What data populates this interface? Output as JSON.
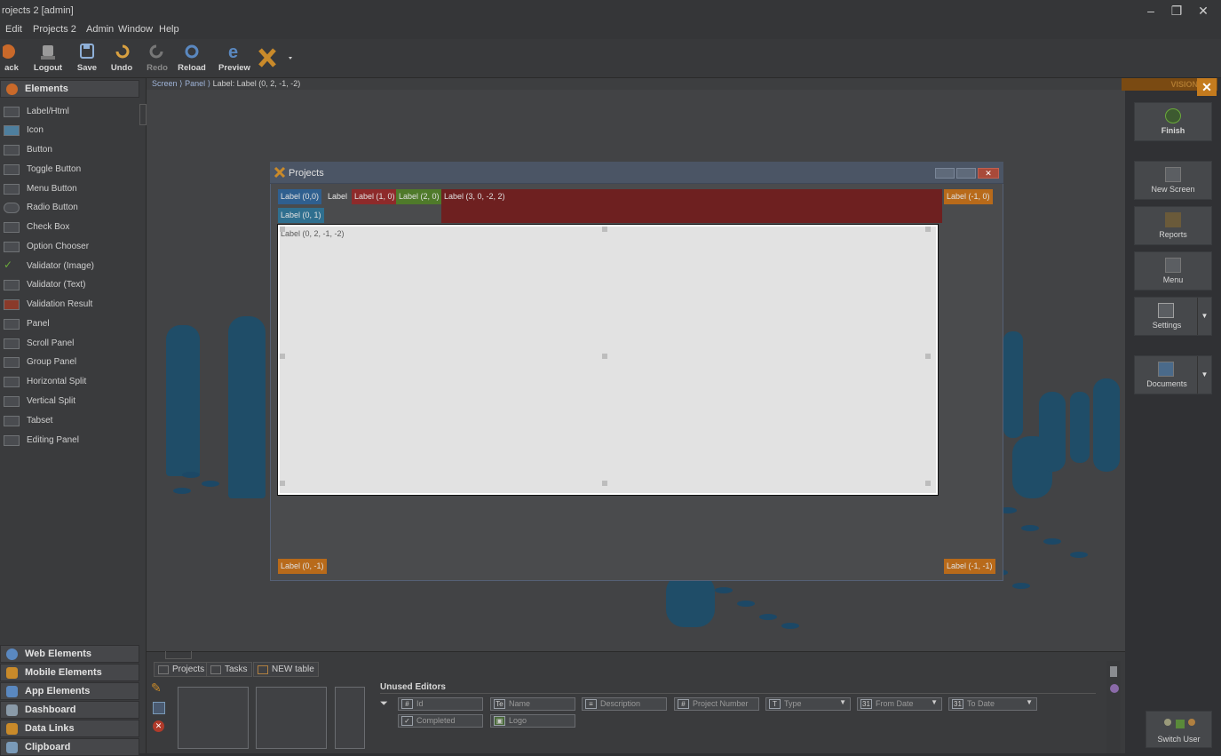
{
  "window": {
    "title": "rojects 2 [admin]",
    "minimize": "–",
    "restore": "❐",
    "close": "✕"
  },
  "menu": [
    "Edit",
    "Projects 2",
    "Admin",
    "Window",
    "Help"
  ],
  "toolbar": {
    "buttons": [
      {
        "label": "ack",
        "icon": "back-icon"
      },
      {
        "label": "Logout",
        "icon": "logout-icon"
      },
      {
        "label": "Save",
        "icon": "save-icon"
      },
      {
        "label": "Undo",
        "icon": "undo-icon"
      },
      {
        "label": "Redo",
        "icon": "redo-icon"
      },
      {
        "label": "Reload",
        "icon": "reload-icon"
      },
      {
        "label": "Preview",
        "icon": "preview-icon"
      }
    ]
  },
  "sidebar": {
    "header": "Elements",
    "items": [
      "Label/Html",
      "Icon",
      "Button",
      "Toggle Button",
      "Menu Button",
      "Radio Button",
      "Check Box",
      "Option Chooser",
      "Validator (Image)",
      "Validator (Text)",
      "Validation Result",
      "Panel",
      "Scroll Panel",
      "Group Panel",
      "Horizontal Split",
      "Vertical Split",
      "Tabset",
      "Editing Panel"
    ],
    "categories": [
      "Web Elements",
      "Mobile Elements",
      "App Elements",
      "Dashboard",
      "Data Links",
      "Clipboard"
    ]
  },
  "breadcrumb": {
    "screen": "Screen",
    "panel": "Panel",
    "current": "Label: Label (0, 2, -1, -2)"
  },
  "designer": {
    "window_title": "Projects",
    "labels": {
      "l00": "Label (0,0)",
      "plain": "Label",
      "l10": "Label (1, 0)",
      "l20": "Label (2, 0)",
      "l30": "Label (3, 0, -2, 2)",
      "lm10": "Label (-1, 0)",
      "l01": "Label (0, 1)",
      "content": "Label (0, 2, -1, -2)",
      "l0m1": "Label (0, -1)",
      "lm1m1": "Label (-1, -1)"
    }
  },
  "right_panel": {
    "header": "VISION",
    "buttons": [
      "Finish",
      "New Screen",
      "Reports",
      "Menu",
      "Settings",
      "Documents"
    ],
    "switch_user": "Switch User"
  },
  "bottom": {
    "tabs": [
      "Projects",
      "Tasks",
      "NEW table"
    ],
    "unused_editors_title": "Unused Editors",
    "fields": [
      {
        "label": "Id",
        "icon": "#"
      },
      {
        "label": "Name",
        "icon": "Te"
      },
      {
        "label": "Description",
        "icon": "≡"
      },
      {
        "label": "Project Number",
        "icon": "#"
      },
      {
        "label": "Type",
        "icon": "T"
      },
      {
        "label": "From Date",
        "icon": "31"
      },
      {
        "label": "To Date",
        "icon": "31"
      },
      {
        "label": "Completed",
        "icon": "✓"
      },
      {
        "label": "Logo",
        "icon": "▣"
      }
    ]
  }
}
